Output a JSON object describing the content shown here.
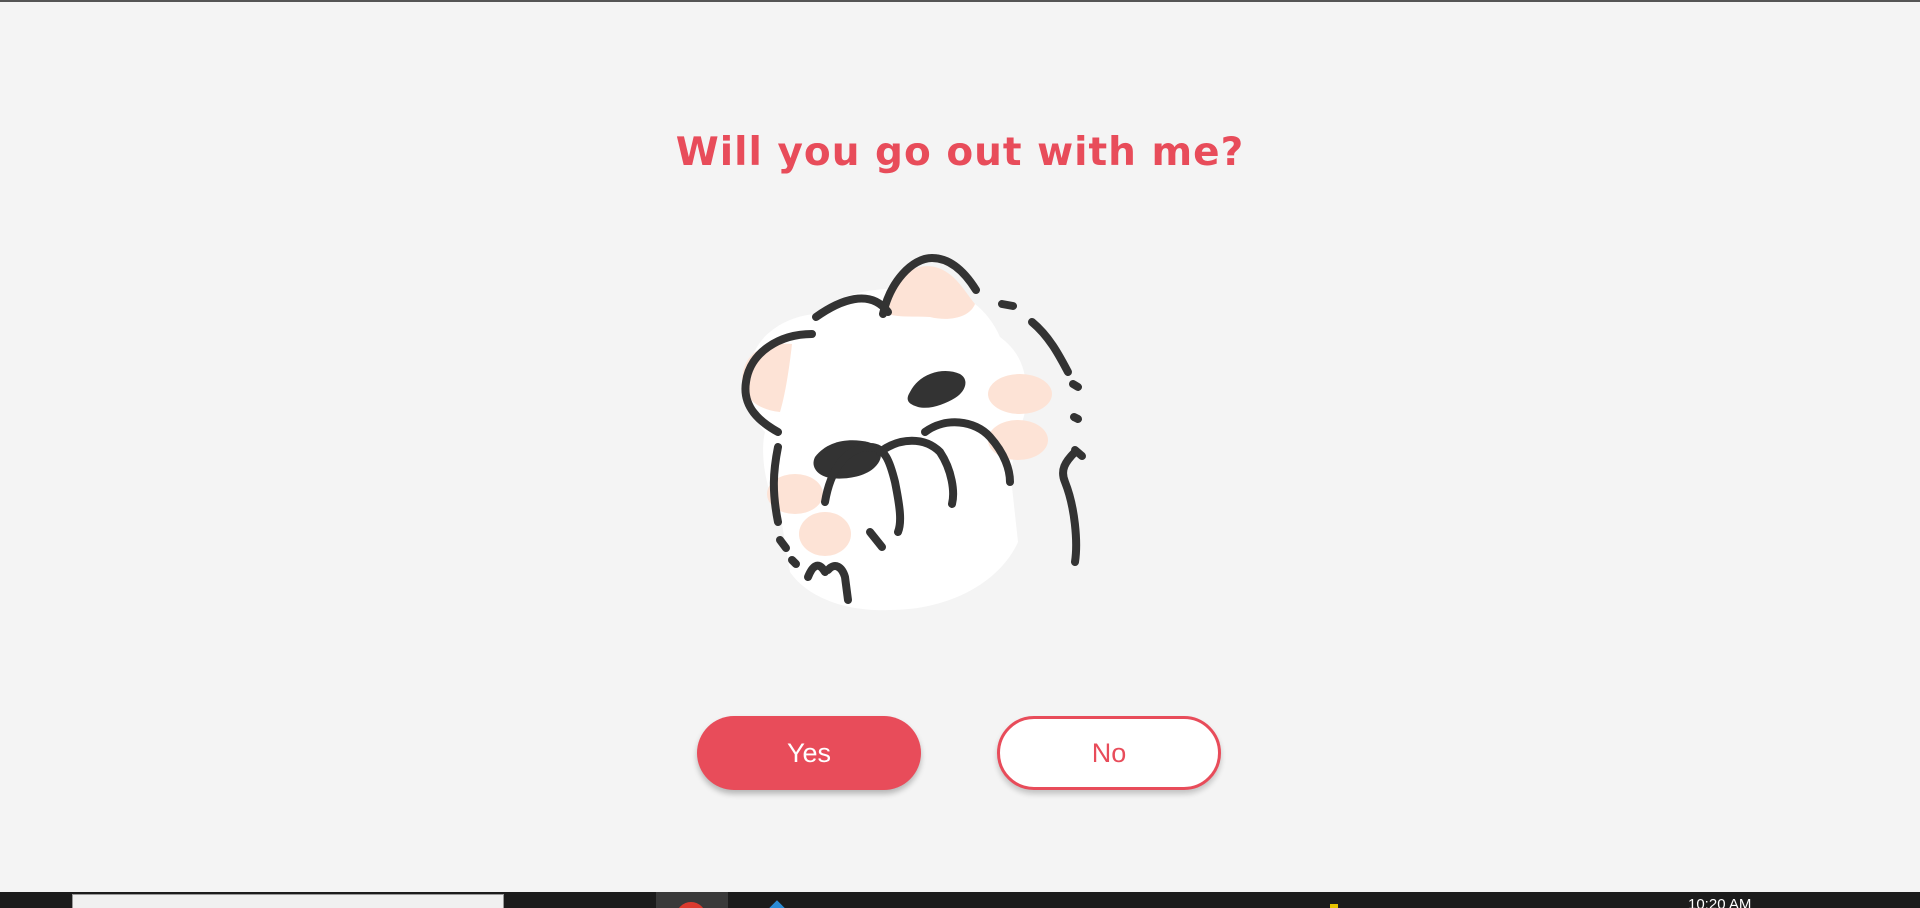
{
  "prompt": {
    "question": "Will you go out with me?"
  },
  "buttons": {
    "yes_label": "Yes",
    "no_label": "No"
  },
  "illustration": {
    "icon": "shy-cat-covering-face"
  },
  "taskbar": {
    "clock": "10:20 AM"
  },
  "colors": {
    "accent": "#e84c5a",
    "background": "#f4f4f4",
    "cat_outline": "#333333",
    "cat_blush": "#fde3d6"
  }
}
